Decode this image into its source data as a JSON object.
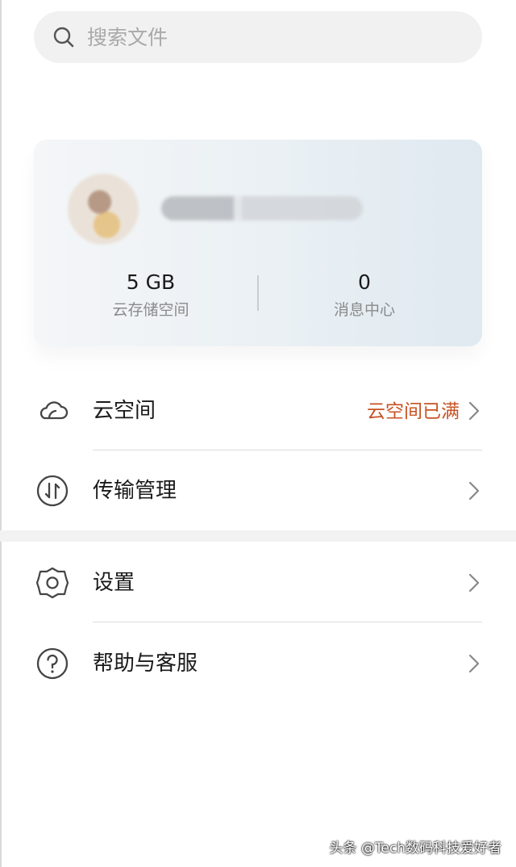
{
  "search": {
    "placeholder": "搜索文件"
  },
  "profile": {
    "storage": {
      "value": "5 GB",
      "label": "云存储空间"
    },
    "messages": {
      "value": "0",
      "label": "消息中心"
    }
  },
  "menu": [
    {
      "label": "云空间",
      "icon": "cloud-icon",
      "status": "云空间已满",
      "status_color": "#c75324"
    },
    {
      "label": "传输管理",
      "icon": "transfer-icon"
    },
    {
      "label": "设置",
      "icon": "gear-icon"
    },
    {
      "label": "帮助与客服",
      "icon": "help-icon"
    }
  ],
  "watermark": "头条 @Tech数码科技爱好者"
}
